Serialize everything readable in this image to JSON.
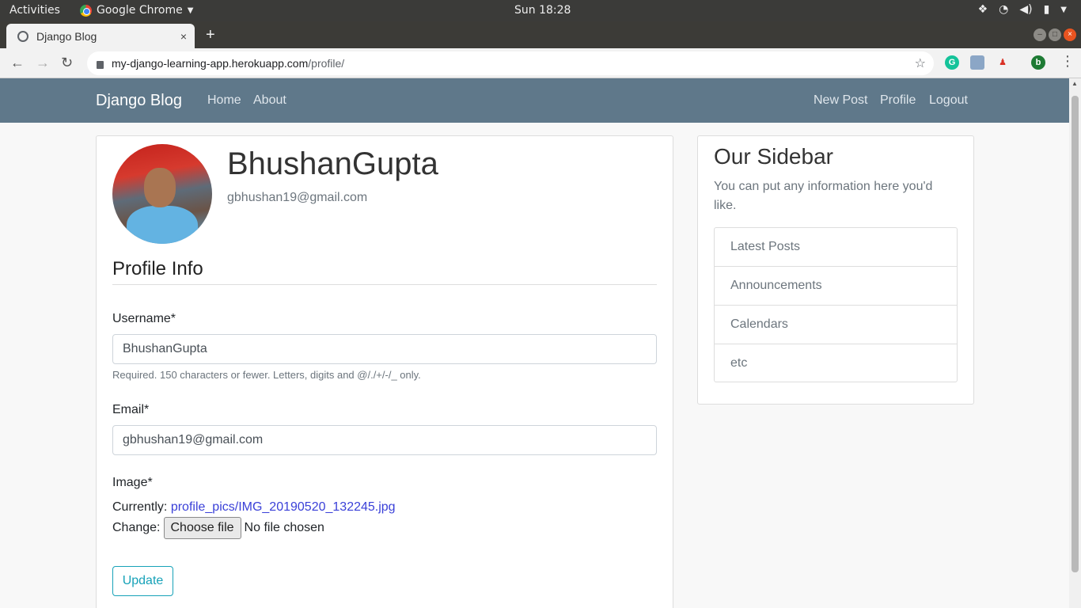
{
  "os": {
    "activities": "Activities",
    "app_name": "Google Chrome",
    "clock": "Sun 18:28"
  },
  "browser": {
    "tab_title": "Django Blog",
    "tab_close": "×",
    "new_tab": "+",
    "url_host": "my-django-learning-app.herokuapp.com",
    "url_path": "/profile/",
    "ext_profile_letter": "b"
  },
  "site": {
    "brand": "Django Blog",
    "nav_left": [
      "Home",
      "About"
    ],
    "nav_right": [
      "New Post",
      "Profile",
      "Logout"
    ]
  },
  "profile": {
    "username": "BhushanGupta",
    "email": "gbhushan19@gmail.com",
    "section_title": "Profile Info",
    "form": {
      "username_label": "Username*",
      "username_value": "BhushanGupta",
      "username_help": "Required. 150 characters or fewer. Letters, digits and @/./+/-/_ only.",
      "email_label": "Email*",
      "email_value": "gbhushan19@gmail.com",
      "image_label": "Image*",
      "currently_label": "Currently:",
      "currently_file": "profile_pics/IMG_20190520_132245.jpg",
      "change_label": "Change:",
      "choose_file": "Choose file",
      "no_file": "No file chosen",
      "submit": "Update"
    }
  },
  "sidebar": {
    "title": "Our Sidebar",
    "text": "You can put any information here you'd like.",
    "items": [
      "Latest Posts",
      "Announcements",
      "Calendars",
      "etc"
    ]
  },
  "colors": {
    "navbar": "#5f788a",
    "accent": "#17a2b8",
    "link": "#3a40d8"
  }
}
